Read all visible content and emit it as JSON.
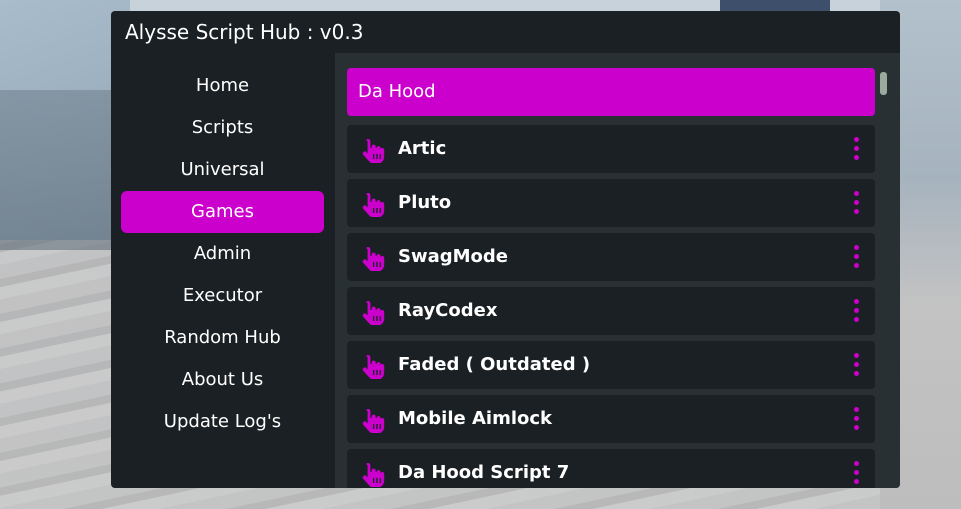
{
  "window": {
    "title": "Alysse Script Hub : v0.3"
  },
  "sidebar": {
    "items": [
      {
        "label": "Home",
        "active": false
      },
      {
        "label": "Scripts",
        "active": false
      },
      {
        "label": "Universal",
        "active": false
      },
      {
        "label": "Games",
        "active": true
      },
      {
        "label": "Admin",
        "active": false
      },
      {
        "label": "Executor",
        "active": false
      },
      {
        "label": "Random Hub",
        "active": false
      },
      {
        "label": "About Us",
        "active": false
      },
      {
        "label": "Update Log's",
        "active": false
      }
    ]
  },
  "content": {
    "section_title": "Da Hood",
    "scripts": [
      {
        "name": "Artic",
        "icon": "pointing-hand-icon"
      },
      {
        "name": "Pluto",
        "icon": "pointing-hand-icon"
      },
      {
        "name": "SwagMode",
        "icon": "pointing-hand-icon"
      },
      {
        "name": "RayCodex",
        "icon": "pointing-hand-icon"
      },
      {
        "name": "Faded ( Outdated )",
        "icon": "pointing-hand-icon"
      },
      {
        "name": "Mobile Aimlock",
        "icon": "pointing-hand-icon"
      },
      {
        "name": "Da Hood Script 7",
        "icon": "pointing-hand-icon"
      }
    ]
  },
  "colors": {
    "accent": "#cc00cc",
    "window_bg": "#1a2023",
    "content_bg": "#283034",
    "text": "#ffffff"
  }
}
